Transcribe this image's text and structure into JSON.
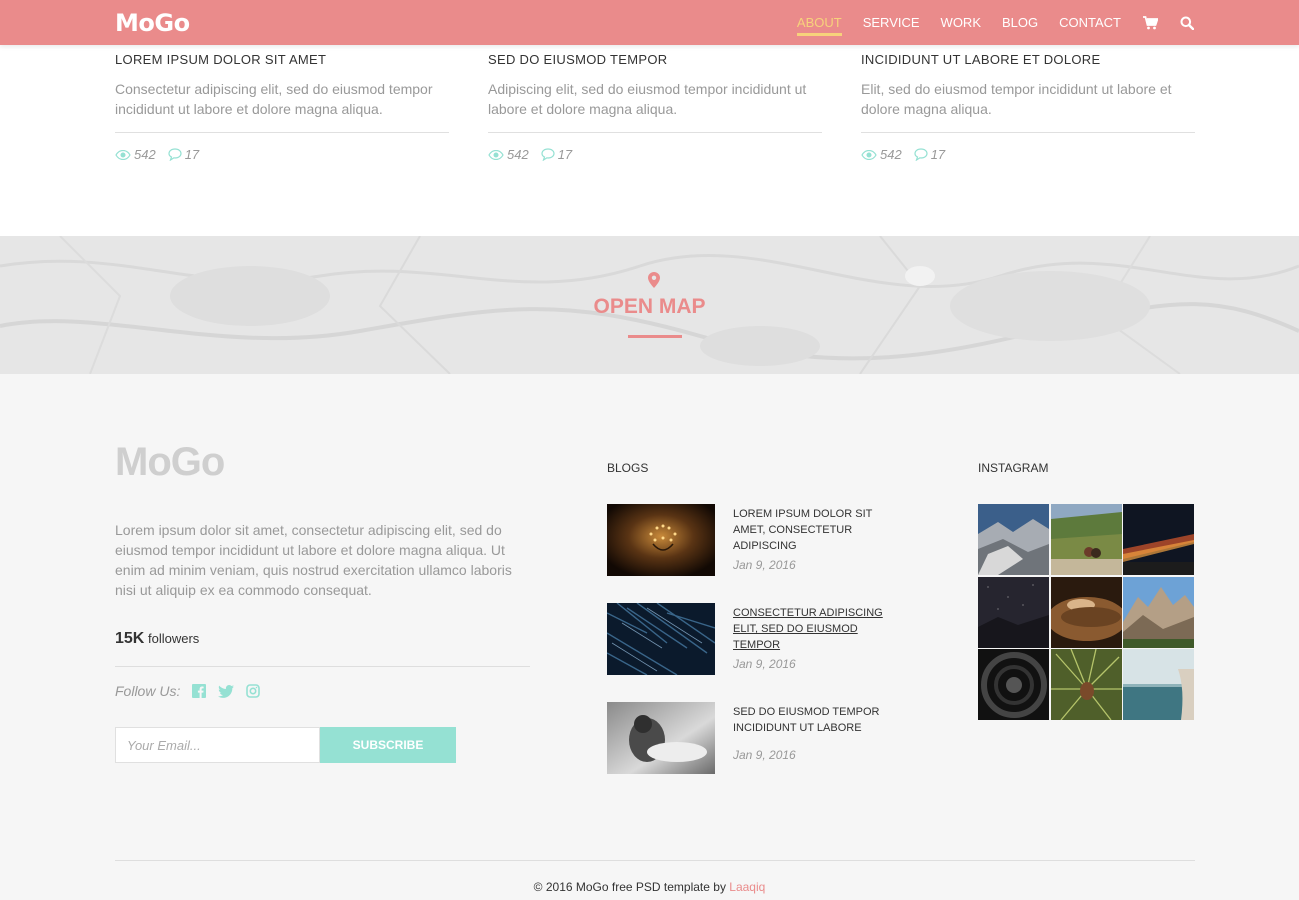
{
  "header": {
    "logo": "MoGo",
    "nav": [
      "ABOUT",
      "SERVICE",
      "WORK",
      "BLOG",
      "CONTACT"
    ],
    "active": "ABOUT",
    "icons": [
      "cart-icon",
      "search-icon"
    ],
    "bg_color": "#ea8b8b",
    "active_color": "#f7d27b"
  },
  "cards": [
    {
      "title": "LOREM IPSUM DOLOR SIT AMET",
      "text": "Consectetur adipiscing elit, sed do eiusmod tempor incididunt ut labore et dolore magna aliqua.",
      "views": "542",
      "comments": "17"
    },
    {
      "title": "SED DO EIUSMOD TEMPOR",
      "text": "Adipiscing elit, sed do eiusmod tempor incididunt ut labore et dolore magna aliqua.",
      "views": "542",
      "comments": "17"
    },
    {
      "title": "INCIDIDUNT UT LABORE ET DOLORE",
      "text": "Elit, sed do eiusmod tempor incididunt ut labore et dolore magna aliqua.",
      "views": "542",
      "comments": "17"
    }
  ],
  "map": {
    "title": "OPEN MAP",
    "icon": "map-pin-icon"
  },
  "footer": {
    "logo": "MoGo",
    "text": "Lorem ipsum dolor sit amet, consectetur adipiscing elit, sed do eiusmod tempor incididunt ut labore et dolore magna aliqua. Ut enim ad minim veniam, quis nostrud exercitation ullamco laboris nisi ut aliquip ex ea commodo consequat.",
    "followers_count": "15K",
    "followers_label": "followers",
    "follow_label": "Follow Us:",
    "social_icons": [
      "facebook-icon",
      "twitter-icon",
      "instagram-icon"
    ],
    "email_placeholder": "Your Email...",
    "subscribe_label": "SUBSCRIBE",
    "blogs_heading": "BLOGS",
    "blogs": [
      {
        "title": "LOREM IPSUM DOLOR SIT AMET, CONSECTETUR ADIPISCING",
        "date": "Jan 9, 2016"
      },
      {
        "title": "CONSECTETUR ADIPISCING ELIT, SED DO EIUSMOD TEMPOR",
        "date": "Jan 9, 2016"
      },
      {
        "title": "SED DO EIUSMOD TEMPOR INCIDIDUNT UT LABORE",
        "date": "Jan 9, 2016"
      }
    ],
    "instagram_heading": "INSTAGRAM",
    "copyright_text": "© 2016 MoGo free PSD template by ",
    "copyright_link": "Laaqiq"
  }
}
